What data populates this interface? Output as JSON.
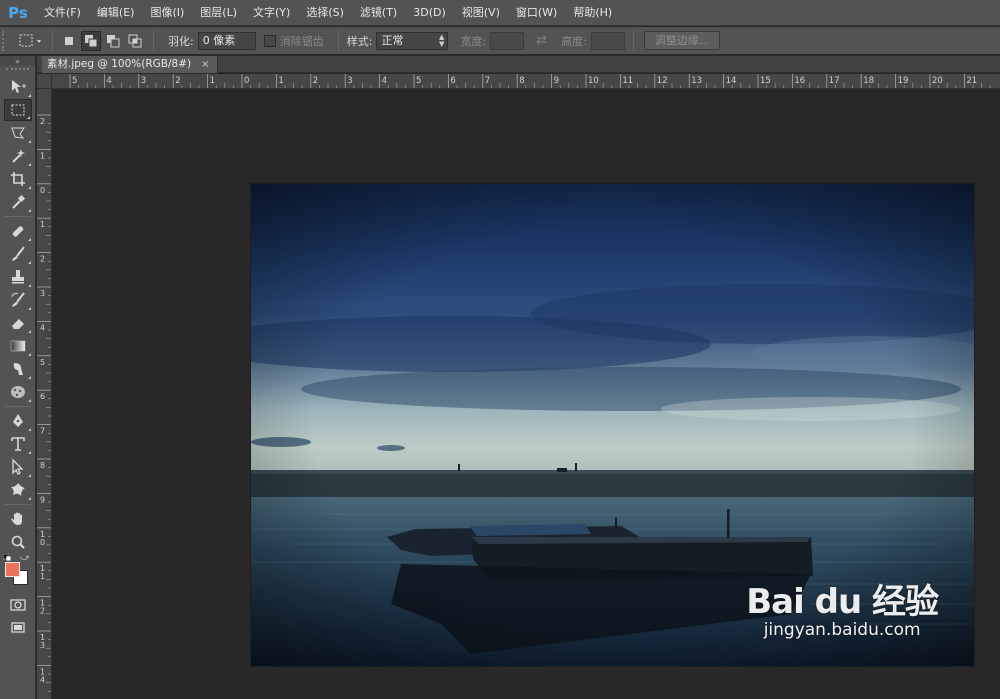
{
  "app": {
    "logo": "Ps"
  },
  "menu": {
    "items": [
      "文件(F)",
      "编辑(E)",
      "图像(I)",
      "图层(L)",
      "文字(Y)",
      "选择(S)",
      "滤镜(T)",
      "3D(D)",
      "视图(V)",
      "窗口(W)",
      "帮助(H)"
    ]
  },
  "options": {
    "feather_label": "羽化:",
    "feather_value": "0 像素",
    "antialias_label": "消除锯齿",
    "style_label": "样式:",
    "style_value": "正常",
    "width_label": "宽度:",
    "height_label": "高度:",
    "refine_edge_label": "调整边缘..."
  },
  "document": {
    "tab_title": "素材.jpeg @ 100%(RGB/8#)",
    "close_glyph": "×"
  },
  "rulers": {
    "top": [
      "5",
      "4",
      "3",
      "2",
      "1",
      "0",
      "1",
      "2",
      "3",
      "4",
      "5",
      "6",
      "7",
      "8",
      "9",
      "10",
      "11",
      "12",
      "13",
      "14",
      "15",
      "16",
      "17",
      "18",
      "19",
      "20",
      "21"
    ],
    "left": [
      "2",
      "1",
      "0",
      "1",
      "2",
      "3",
      "4",
      "5",
      "6",
      "7",
      "8",
      "9",
      "1 0",
      "1 1",
      "1 2",
      "1 3",
      "1 4"
    ]
  },
  "watermark": {
    "brand": "Bai du 经验",
    "url": "jingyan.baidu.com"
  },
  "colors": {
    "foreground": "#e9735e",
    "background": "#ffffff",
    "accent": "#4aa8f0"
  }
}
